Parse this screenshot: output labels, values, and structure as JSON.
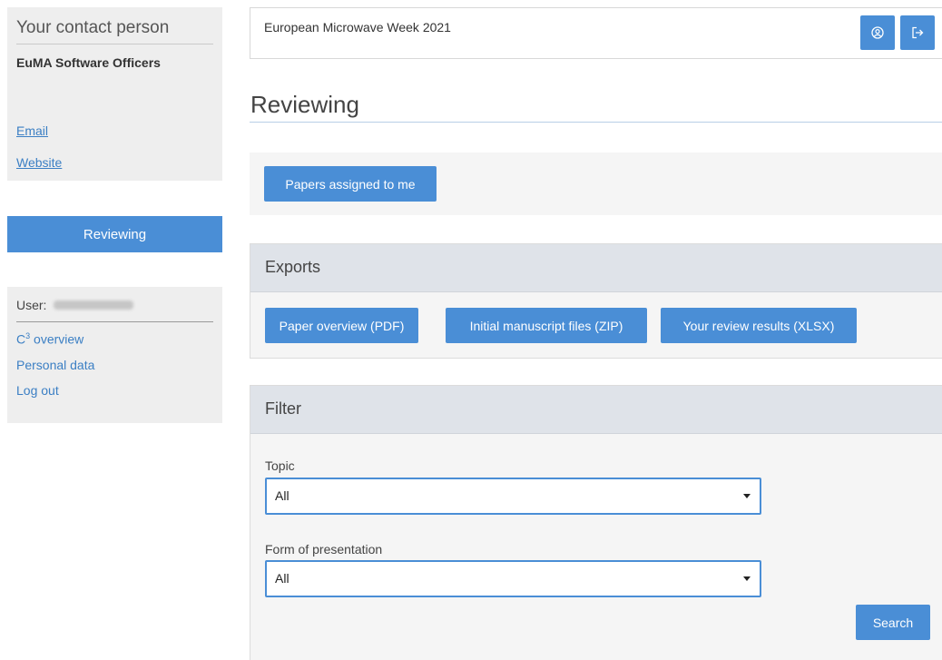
{
  "sidebar": {
    "contact": {
      "title": "Your contact person",
      "name": "EuMA Software Officers",
      "email_label": "Email",
      "website_label": "Website"
    },
    "nav": {
      "reviewing_label": "Reviewing"
    },
    "user": {
      "label": "User:",
      "overview_prefix": "C",
      "overview_sup": "3",
      "overview_suffix": " overview",
      "personal_data_label": "Personal data",
      "logout_label": "Log out"
    }
  },
  "header": {
    "event_name": "European Microwave Week 2021",
    "icons": [
      "user-circle-icon",
      "logout-icon"
    ]
  },
  "main": {
    "title": "Reviewing",
    "assigned_button": "Papers assigned to me",
    "exports": {
      "title": "Exports",
      "pdf_button": "Paper overview (PDF)",
      "zip_button": "Initial manuscript files (ZIP)",
      "xlsx_button": "Your review results (XLSX)"
    },
    "filter": {
      "title": "Filter",
      "topic_label": "Topic",
      "topic_value": "All",
      "form_label": "Form of presentation",
      "form_value": "All",
      "search_button": "Search"
    }
  },
  "colors": {
    "accent": "#4a8ed6",
    "link": "#3b7fc4",
    "sidebar_bg": "#eeeeee",
    "panel_head_bg": "#dfe3e9"
  }
}
